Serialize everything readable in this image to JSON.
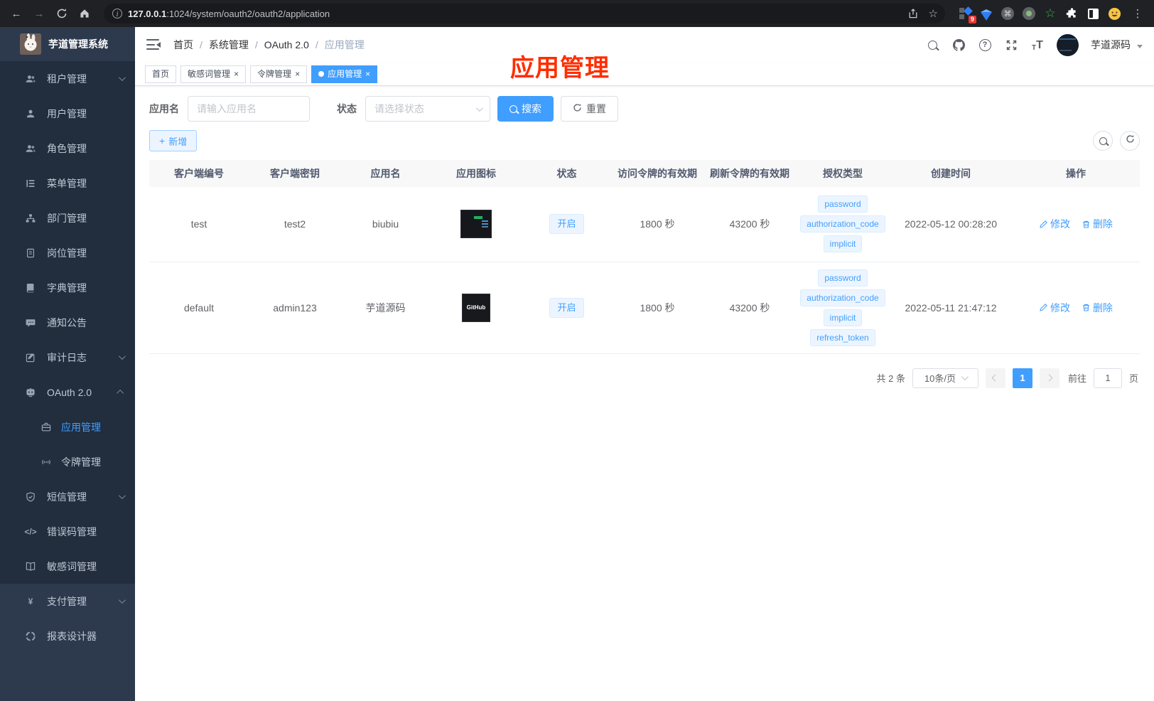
{
  "colors": {
    "accent": "#409eff",
    "annotation_red": "#ff2d00",
    "sidebar_dark": "#222d3e",
    "sidebar_light": "#2d3a4e"
  },
  "browser": {
    "url_host": "127.0.0.1",
    "url_path": ":1024/system/oauth2/oauth2/application",
    "extension_badge": "9"
  },
  "sidebar": {
    "title": "芋道管理系统",
    "items": [
      {
        "label": "租户管理"
      },
      {
        "label": "用户管理"
      },
      {
        "label": "角色管理"
      },
      {
        "label": "菜单管理"
      },
      {
        "label": "部门管理"
      },
      {
        "label": "岗位管理"
      },
      {
        "label": "字典管理"
      },
      {
        "label": "通知公告"
      },
      {
        "label": "审计日志"
      },
      {
        "label": "OAuth 2.0"
      },
      {
        "label": "应用管理"
      },
      {
        "label": "令牌管理"
      },
      {
        "label": "短信管理"
      },
      {
        "label": "错误码管理"
      },
      {
        "label": "敏感词管理"
      },
      {
        "label": "支付管理"
      },
      {
        "label": "报表设计器"
      }
    ],
    "code_icon_text": "</>",
    "yen_icon_text": "¥"
  },
  "navbar": {
    "breadcrumb": [
      "首页",
      "系统管理",
      "OAuth 2.0",
      "应用管理"
    ],
    "username": "芋道源码"
  },
  "tabs": {
    "items": [
      {
        "label": "首页"
      },
      {
        "label": "敏感词管理"
      },
      {
        "label": "令牌管理"
      },
      {
        "label": "应用管理"
      }
    ]
  },
  "annotation": {
    "text": "应用管理"
  },
  "filters": {
    "name_label": "应用名",
    "name_placeholder": "请输入应用名",
    "status_label": "状态",
    "status_placeholder": "请选择状态",
    "search_label": "搜索",
    "reset_label": "重置"
  },
  "toolbar": {
    "add_label": "新增"
  },
  "table": {
    "columns": [
      "客户端编号",
      "客户端密钥",
      "应用名",
      "应用图标",
      "状态",
      "访问令牌的有效期",
      "刷新令牌的有效期",
      "授权类型",
      "创建时间",
      "操作"
    ],
    "rows": [
      {
        "client_id": "test",
        "client_secret": "test2",
        "name": "biubiu",
        "status": "开启",
        "access_token_ttl": "1800 秒",
        "refresh_token_ttl": "43200 秒",
        "grant_types": [
          "password",
          "authorization_code",
          "implicit"
        ],
        "created_at": "2022-05-12 00:28:20"
      },
      {
        "client_id": "default",
        "client_secret": "admin123",
        "name": "芋道源码",
        "icon_text": "GitHub",
        "status": "开启",
        "access_token_ttl": "1800 秒",
        "refresh_token_ttl": "43200 秒",
        "grant_types": [
          "password",
          "authorization_code",
          "implicit",
          "refresh_token"
        ],
        "created_at": "2022-05-11 21:47:12"
      }
    ],
    "actions": {
      "edit": "修改",
      "delete": "删除"
    }
  },
  "pagination": {
    "total_text": "共 2 条",
    "page_size_text": "10条/页",
    "current_page": "1",
    "goto_label": "前往",
    "goto_value": "1",
    "page_unit": "页"
  }
}
